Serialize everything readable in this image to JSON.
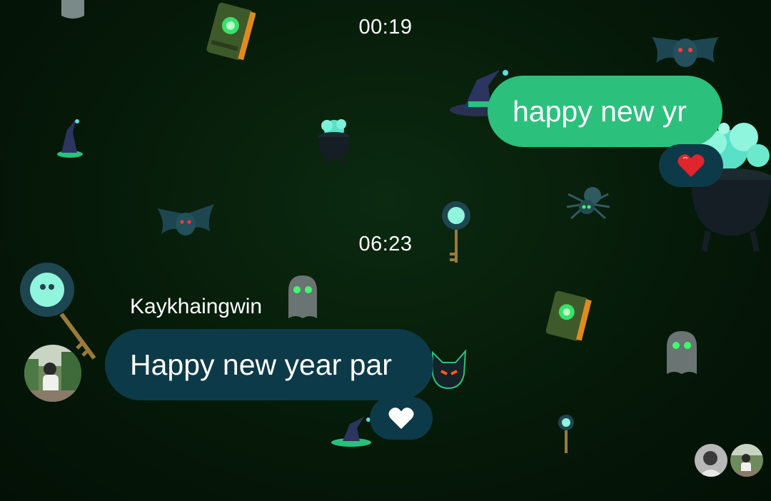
{
  "chat": {
    "timestamps": [
      "00:19",
      "06:23"
    ],
    "messages": [
      {
        "direction": "sent",
        "text": "happy new yr",
        "reaction": "red-heart"
      },
      {
        "direction": "received",
        "sender": "Kaykhaingwin",
        "text": "Happy new year par",
        "reaction": "white-heart"
      }
    ],
    "theme": "halloween",
    "colors": {
      "background": "#061a09",
      "sent_bubble": "#2cc07d",
      "received_bubble": "#0d3a48",
      "text": "#ffffff",
      "heart_red": "#e0252d",
      "heart_white": "#ffffff"
    }
  },
  "decorations": [
    "spellbook-icon",
    "bat-icon",
    "witch-hat-icon",
    "cauldron-icon",
    "spider-icon",
    "skull-key-icon",
    "ghost-icon",
    "black-cat-icon"
  ],
  "read_receipts": [
    "contact-avatar",
    "user-avatar"
  ]
}
